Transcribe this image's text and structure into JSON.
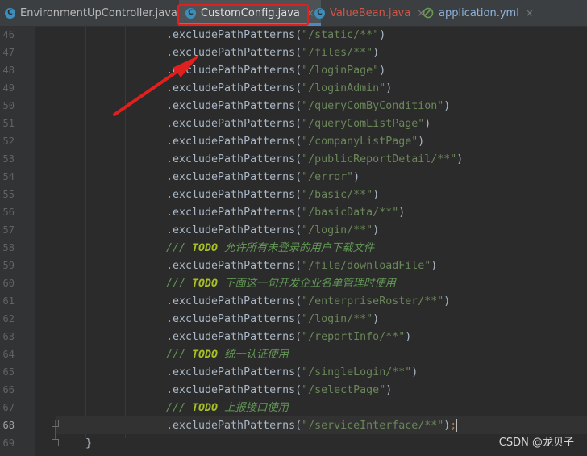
{
  "tabs": [
    {
      "label": "EnvironmentUpController.java",
      "icon": "java-class-icon",
      "active": false
    },
    {
      "label": "CustomConfig.java",
      "icon": "java-class-icon",
      "active": true
    },
    {
      "label": "ValueBean.java",
      "icon": "java-class-icon",
      "active": false
    },
    {
      "label": "application.yml",
      "icon": "yaml-file-icon",
      "active": false
    }
  ],
  "tab_icon_letter": "C",
  "close_glyph": "×",
  "lines": [
    {
      "no": "46",
      "kind": "call",
      "pre": ".excludePathPatterns(",
      "str": "\"/static/**\"",
      "post": ")"
    },
    {
      "no": "47",
      "kind": "call",
      "pre": ".excludePathPatterns(",
      "str": "\"/files/**\"",
      "post": ")"
    },
    {
      "no": "48",
      "kind": "call",
      "pre": ".excludePathPatterns(",
      "str": "\"/loginPage\"",
      "post": ")"
    },
    {
      "no": "49",
      "kind": "call",
      "pre": ".excludePathPatterns(",
      "str": "\"/loginAdmin\"",
      "post": ")"
    },
    {
      "no": "50",
      "kind": "call",
      "pre": ".excludePathPatterns(",
      "str": "\"/queryComByCondition\"",
      "post": ")"
    },
    {
      "no": "51",
      "kind": "call",
      "pre": ".excludePathPatterns(",
      "str": "\"/queryComListPage\"",
      "post": ")"
    },
    {
      "no": "52",
      "kind": "call",
      "pre": ".excludePathPatterns(",
      "str": "\"/companyListPage\"",
      "post": ")"
    },
    {
      "no": "53",
      "kind": "call",
      "pre": ".excludePathPatterns(",
      "str": "\"/publicReportDetail/**\"",
      "post": ")"
    },
    {
      "no": "54",
      "kind": "call",
      "pre": ".excludePathPatterns(",
      "str": "\"/error\"",
      "post": ")"
    },
    {
      "no": "55",
      "kind": "call",
      "pre": ".excludePathPatterns(",
      "str": "\"/basic/**\"",
      "post": ")"
    },
    {
      "no": "56",
      "kind": "call",
      "pre": ".excludePathPatterns(",
      "str": "\"/basicData/**\"",
      "post": ")"
    },
    {
      "no": "57",
      "kind": "call",
      "pre": ".excludePathPatterns(",
      "str": "\"/login/**\"",
      "post": ")"
    },
    {
      "no": "58",
      "kind": "comment",
      "slashes": "/// ",
      "todo": "TODO",
      "text": " 允许所有未登录的用户下载文件"
    },
    {
      "no": "59",
      "kind": "call",
      "pre": ".excludePathPatterns(",
      "str": "\"/file/downloadFile\"",
      "post": ")"
    },
    {
      "no": "60",
      "kind": "comment",
      "slashes": "/// ",
      "todo": "TODO",
      "text": " 下面这一句开发企业名单管理时使用"
    },
    {
      "no": "61",
      "kind": "call",
      "pre": ".excludePathPatterns(",
      "str": "\"/enterpriseRoster/**\"",
      "post": ")"
    },
    {
      "no": "62",
      "kind": "call",
      "pre": ".excludePathPatterns(",
      "str": "\"/login/**\"",
      "post": ")"
    },
    {
      "no": "63",
      "kind": "call",
      "pre": ".excludePathPatterns(",
      "str": "\"/reportInfo/**\"",
      "post": ")"
    },
    {
      "no": "64",
      "kind": "comment",
      "slashes": "/// ",
      "todo": "TODO",
      "text": " 统一认证使用"
    },
    {
      "no": "65",
      "kind": "call",
      "pre": ".excludePathPatterns(",
      "str": "\"/singleLogin/**\"",
      "post": ")"
    },
    {
      "no": "66",
      "kind": "call",
      "pre": ".excludePathPatterns(",
      "str": "\"/selectPage\"",
      "post": ")"
    },
    {
      "no": "67",
      "kind": "comment",
      "slashes": "/// ",
      "todo": "TODO",
      "text": " 上报接口使用"
    },
    {
      "no": "68",
      "kind": "call",
      "pre": ".excludePathPatterns(",
      "str": "\"/serviceInterface/**\"",
      "post": ")",
      "semicolon": ";"
    },
    {
      "no": "69",
      "kind": "brace",
      "text": "}"
    }
  ],
  "current_line": "68",
  "watermark": "CSDN @龙贝子",
  "colors": {
    "annotation_red": "#e0201e",
    "string": "#6a8759",
    "comment": "#629755",
    "todo": "#a8c023",
    "code": "#a9b7c6"
  }
}
